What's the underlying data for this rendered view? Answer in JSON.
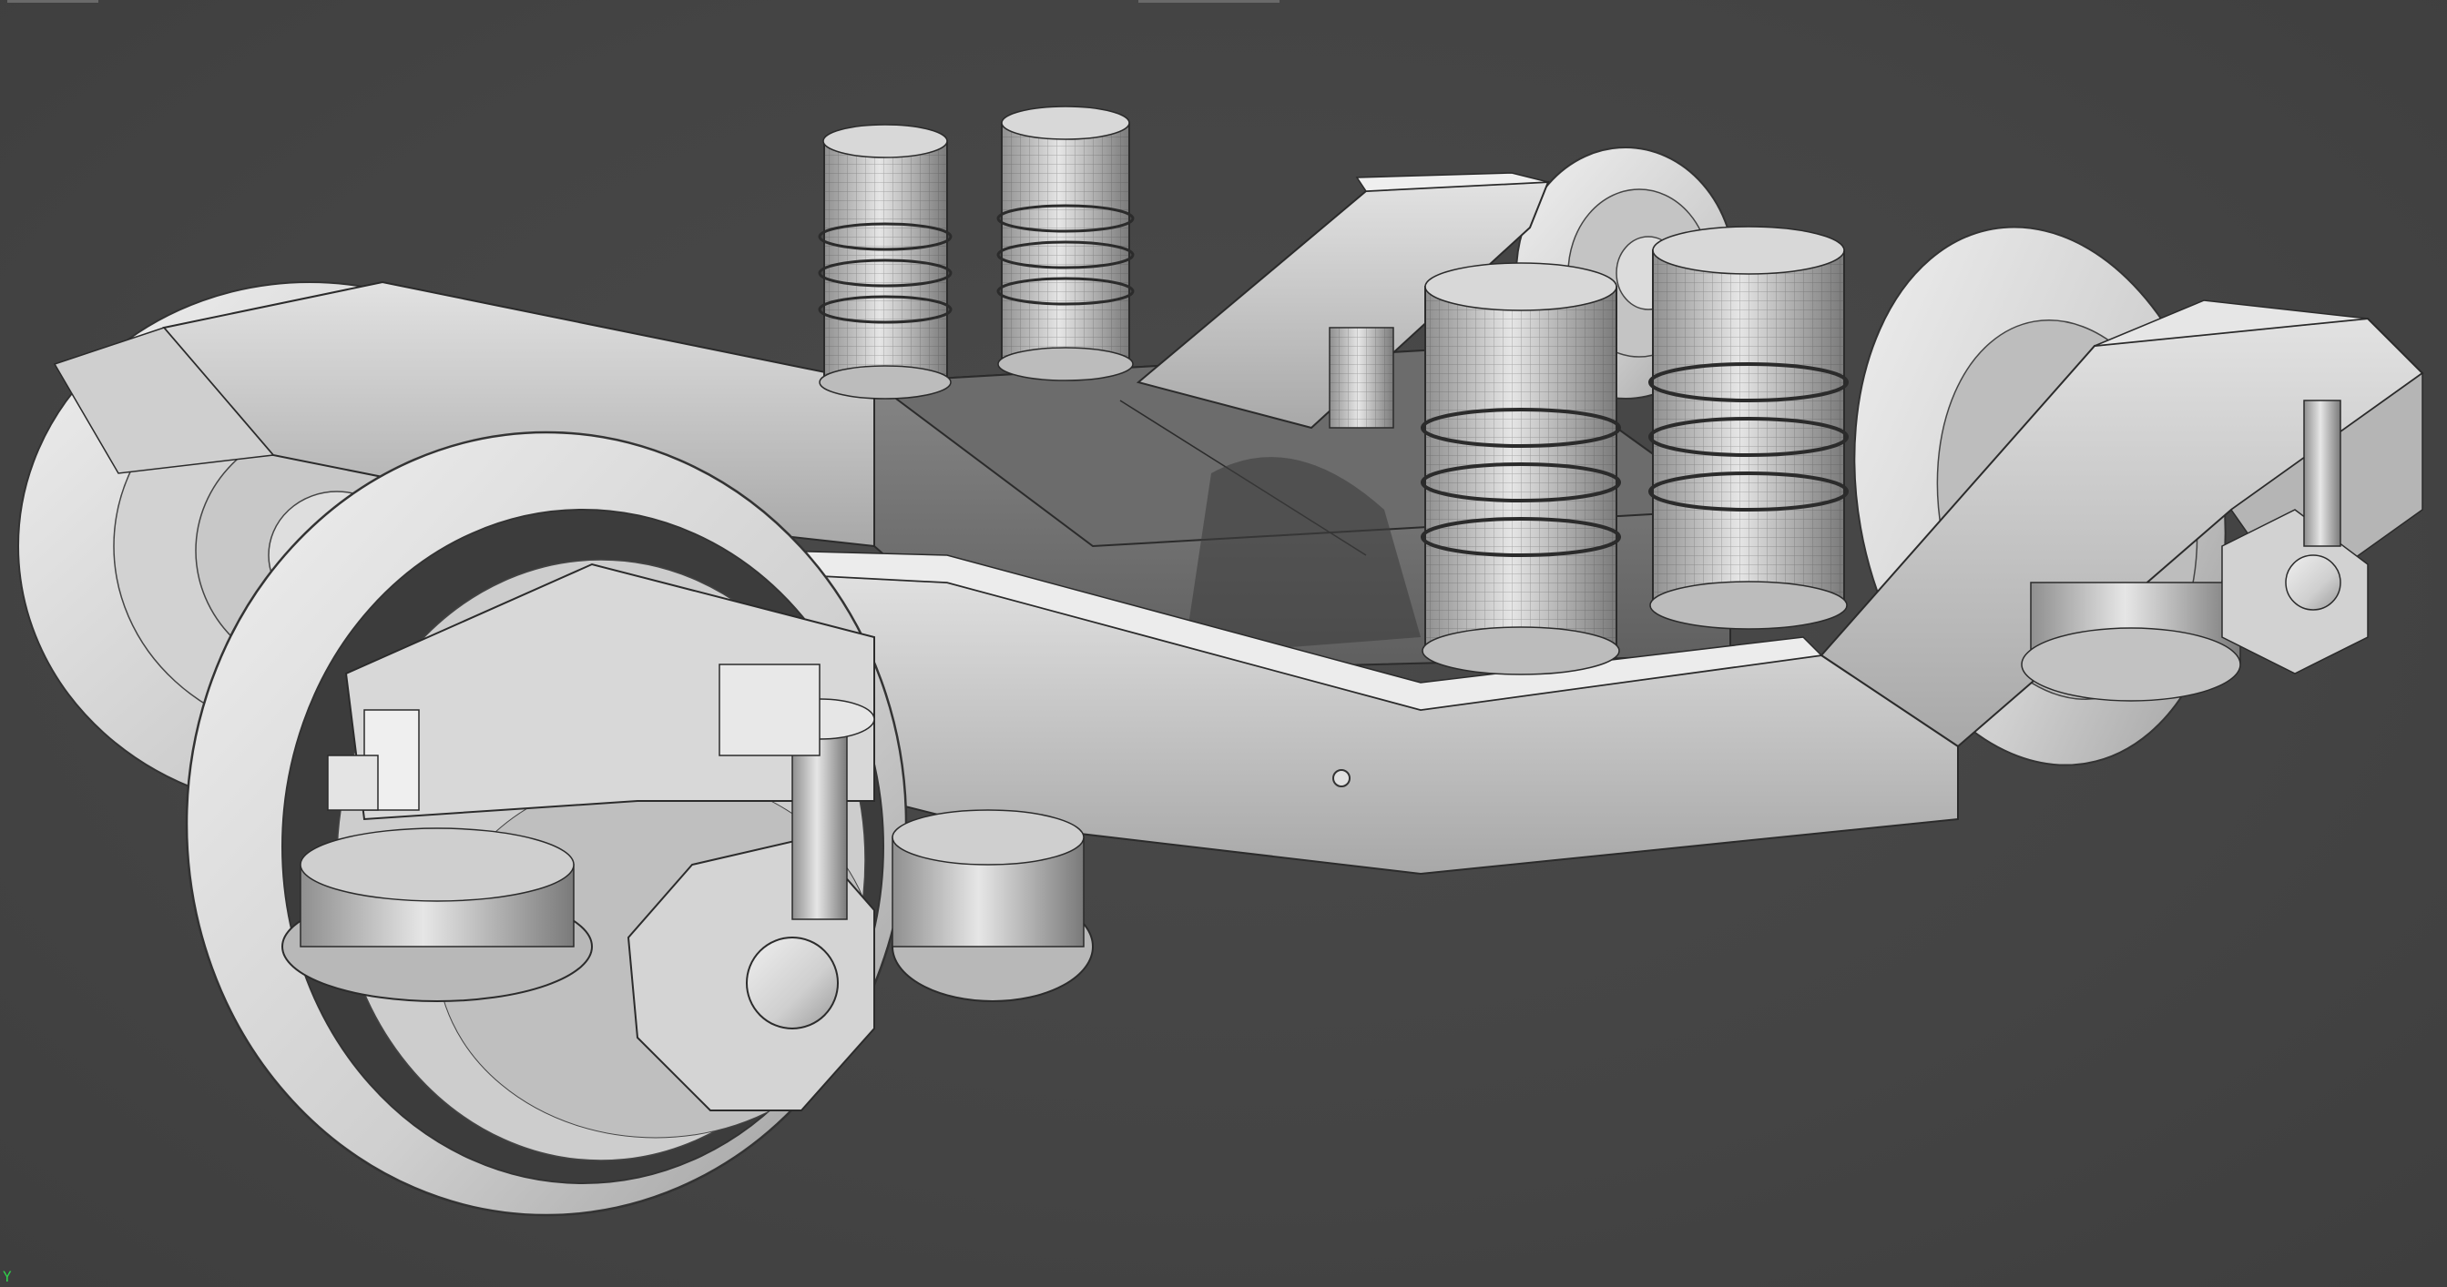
{
  "viewport": {
    "axis_indicator": "Y"
  },
  "colors": {
    "background": "#454545",
    "model_surface": "#d6d6d6",
    "wireframe": "#303030",
    "axis_indicator": "#2fd04a"
  },
  "icons": {
    "axis_gizmo": "axis-y-indicator"
  }
}
